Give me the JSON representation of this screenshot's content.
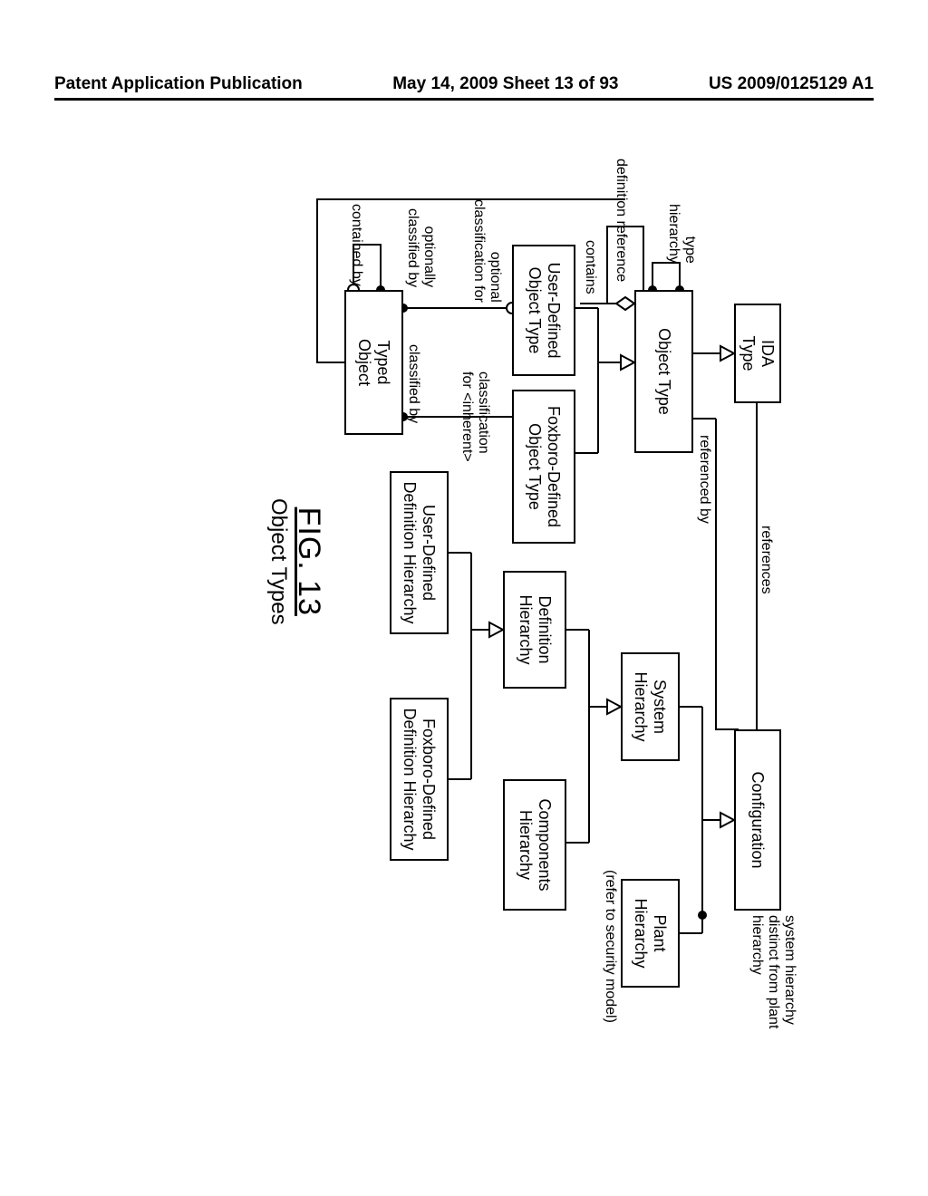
{
  "header": {
    "left": "Patent Application Publication",
    "center": "May 14, 2009  Sheet 13 of 93",
    "right": "US 2009/0125129 A1"
  },
  "boxes": {
    "ida_type": "IDA\nType",
    "configuration": "Configuration",
    "object_type": "Object Type",
    "system_hierarchy": "System\nHierarchy",
    "plant_hierarchy": "Plant\nHierarchy",
    "user_defined_obj_type": "User-Defined\nObject Type",
    "foxboro_defined_obj_type": "Foxboro-Defined\nObject Type",
    "definition_hierarchy": "Definition\nHierarchy",
    "components_hierarchy": "Components\nHierarchy",
    "typed_object": "Typed\nObject",
    "user_defined_def_hierarchy": "User-Defined\nDefinition Hierarchy",
    "foxboro_defined_def_hierarchy": "Foxboro-Defined\nDefinition Hierarchy"
  },
  "labels": {
    "references": "references",
    "referenced_by": "referenced by",
    "system_note": "system hierarchy\ndistinct from plant\nhierarchy",
    "security_note": "(refer to security model)",
    "type_hierarchy": "type\nhierarchy",
    "definition_reference": "definition reference",
    "contains": "contains",
    "optional_classification_for": "optional\nclassification for",
    "optionally_classified_by": "optionally\nclassified by",
    "classification_for_inherent": "classification\nfor <inherent>",
    "classified_by": "classified by",
    "contained_by": "contained by"
  },
  "figure": {
    "number": "FIG. 13",
    "caption": "Object Types"
  }
}
